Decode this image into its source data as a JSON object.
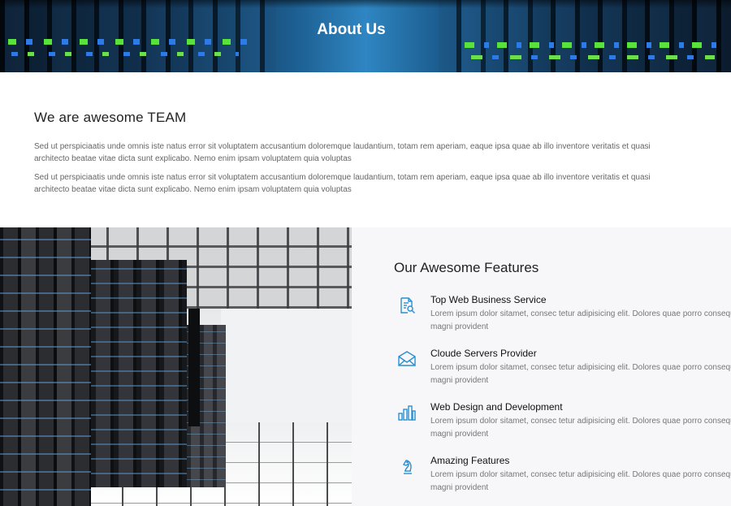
{
  "hero": {
    "title": "About Us"
  },
  "team": {
    "heading": "We are awesome TEAM",
    "paragraphs": [
      {
        "line1": "Sed ut perspiciaatis unde omnis iste natus error sit voluptatem accusantium doloremque laudantium, totam rem aperiam, eaque ipsa quae ab illo inventore veritatis et quasi",
        "line2": "architecto beatae vitae dicta sunt explicabo. Nemo enim ipsam voluptatem quia voluptas"
      },
      {
        "line1": "Sed ut perspiciaatis unde omnis iste natus error sit voluptatem accusantium doloremque laudantium, totam rem aperiam, eaque ipsa quae ab illo inventore veritatis et quasi",
        "line2": "architecto beatae vitae dicta sunt explicabo. Nemo enim ipsam voluptatem quia voluptas"
      }
    ]
  },
  "features": {
    "heading": "Our Awesome Features",
    "accent_color": "#2a8fcf",
    "items": [
      {
        "icon": "document-search-icon",
        "title": "Top Web Business Service",
        "line1": "Lorem ipsum dolor sitamet, consec tetur adipisicing elit. Dolores quae porro consequatur",
        "line2": "magni provident"
      },
      {
        "icon": "envelope-icon",
        "title": "Cloude Servers Provider",
        "line1": "Lorem ipsum dolor sitamet, consec tetur adipisicing elit. Dolores quae porro consequatur",
        "line2": "magni provident"
      },
      {
        "icon": "bar-chart-icon",
        "title": "Web Design and Development",
        "line1": "Lorem ipsum dolor sitamet, consec tetur adipisicing elit. Dolores quae porro consequatur",
        "line2": "magni provident"
      },
      {
        "icon": "chess-knight-icon",
        "title": "Amazing Features",
        "line1": "Lorem ipsum dolor sitamet, consec tetur adipisicing elit. Dolores quae porro consequatur",
        "line2": "magni provident"
      }
    ]
  }
}
